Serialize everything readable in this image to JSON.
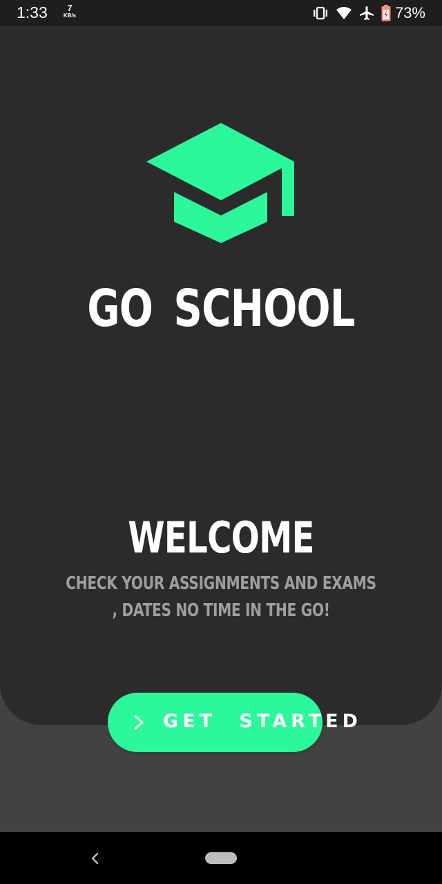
{
  "status_bar": {
    "time": "1:33",
    "net_speed_value": "7",
    "net_speed_unit": "KB/s",
    "icons": [
      "vibrate-icon",
      "wifi-icon",
      "airplane-icon",
      "battery-icon"
    ],
    "battery_percent": "73%"
  },
  "app": {
    "logo_icon": "graduation-cap-icon",
    "title": "GO SCHOOL"
  },
  "welcome": {
    "title": "WELCOME",
    "subtitle_line1": "CHECK YOUR ASSIGNMENTS AND EXAMS",
    "subtitle_line2": ", DATES NO TIME IN THE GO!"
  },
  "cta": {
    "icon": "chevron-right-icon",
    "label": "GET STARTED"
  },
  "nav_bar": {
    "icons": [
      "back-icon",
      "home-pill"
    ]
  },
  "colors": {
    "accent": "#2cf79a",
    "card_background": "#2b2b2b",
    "page_background": "#424242",
    "status_bar": "#1e1e1e",
    "subtitle_text": "#9e9e9e"
  }
}
